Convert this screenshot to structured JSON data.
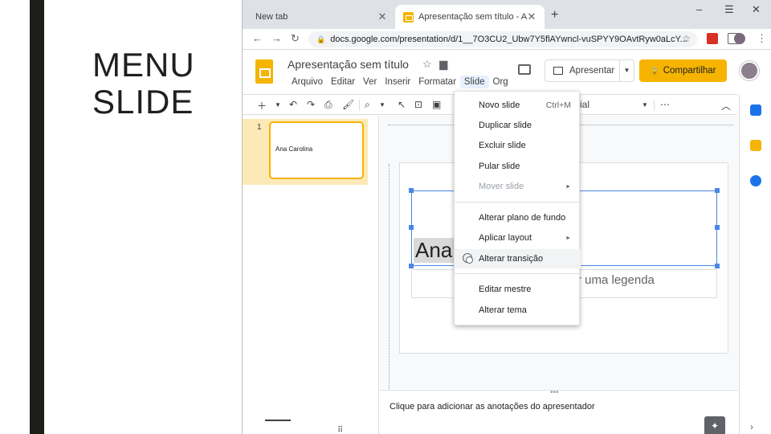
{
  "slide_title": "MENU\nSLIDE",
  "browser": {
    "tabs": [
      {
        "label": "New tab"
      },
      {
        "label": "Apresentação sem título - Apresc"
      }
    ],
    "url": "docs.google.com/presentation/d/1__7O3CU2_Ubw7Y5flAYwncl-vuSPYY9OAvtRyw0aLcY...",
    "window_controls": [
      "–",
      "☰",
      "✕"
    ]
  },
  "docs": {
    "title": "Apresentação sem título",
    "menus": [
      "Arquivo",
      "Editar",
      "Ver",
      "Inserir",
      "Formatar",
      "Slide",
      "Org"
    ],
    "open_menu": "Slide",
    "present_label": "Apresentar",
    "share_label": "Compartilhar",
    "font_name": "Arial"
  },
  "filmstrip": {
    "slide_number": "1",
    "thumb_text": "Ana Carolina"
  },
  "canvas": {
    "title_text": "Ana",
    "subtitle_text": "r uma legenda"
  },
  "notes": {
    "placeholder": "Clique para adicionar as anotações do apresentador"
  },
  "slide_menu": {
    "items": [
      {
        "label": "Novo slide",
        "shortcut": "Ctrl+M"
      },
      {
        "label": "Duplicar slide"
      },
      {
        "label": "Excluir slide"
      },
      {
        "label": "Pular slide"
      },
      {
        "label": "Mover slide",
        "submenu": "►",
        "disabled": true
      },
      {
        "label": "Alterar plano de fundo"
      },
      {
        "label": "Aplicar layout",
        "submenu": "►"
      },
      {
        "label": "Alterar transição",
        "highlighted": true
      },
      {
        "label": "Editar mestre"
      },
      {
        "label": "Alterar tema"
      }
    ]
  },
  "colors": {
    "share_button": "#f6b400",
    "selection_blue": "#4a86e8",
    "dark_bar": "#1e1e18"
  }
}
